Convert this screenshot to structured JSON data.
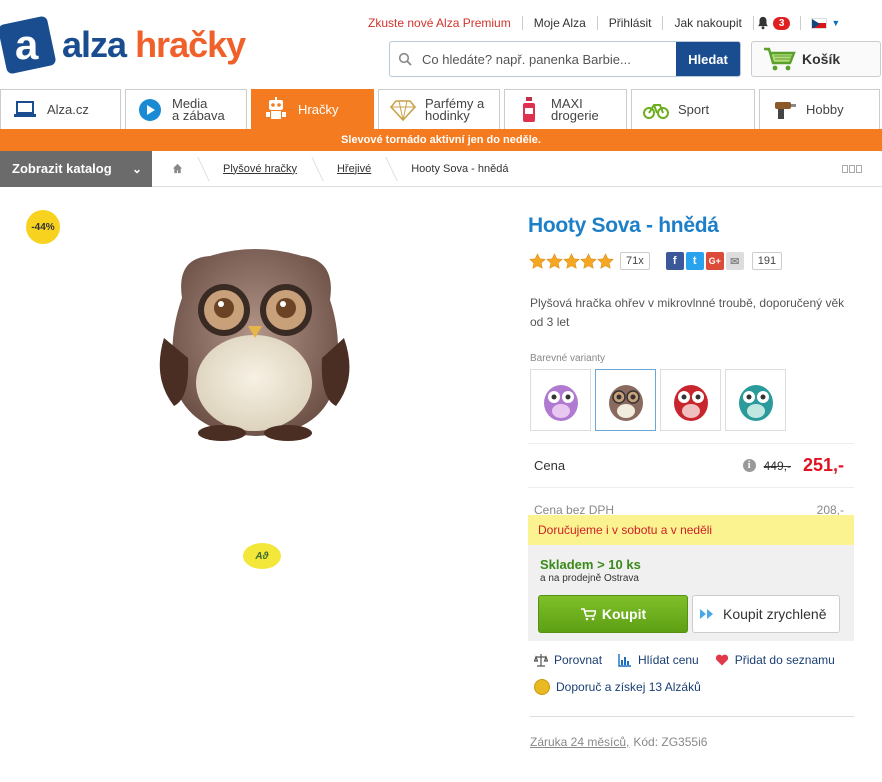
{
  "header": {
    "logo_text_1": "alza",
    "logo_text_2": "hračky",
    "logo_mark": "a",
    "toplinks": {
      "premium": "Zkuste nové Alza Premium",
      "my_alza": "Moje Alza",
      "login": "Přihlásit",
      "how_to_buy": "Jak nakoupit"
    },
    "notifications_count": "3",
    "search": {
      "placeholder": "Co hledáte? např. panenka Barbie...",
      "button": "Hledat"
    },
    "cart_label": "Košík"
  },
  "nav": {
    "tabs": [
      {
        "label": "Alza.cz",
        "icon": "laptop-icon"
      },
      {
        "label": "Media\na zábava",
        "icon": "play-icon"
      },
      {
        "label": "Hračky",
        "icon": "robot-icon"
      },
      {
        "label": "Parfémy a\nhodinky",
        "icon": "diamond-icon"
      },
      {
        "label": "MAXI\ndrogerie",
        "icon": "bottle-icon"
      },
      {
        "label": "Sport",
        "icon": "bicycle-icon"
      },
      {
        "label": "Hobby",
        "icon": "drill-icon"
      }
    ],
    "promo": "Slevové tornádo aktivní jen do neděle."
  },
  "breadcrumb": {
    "catalog_button": "Zobrazit katalog",
    "items": [
      "Plyšové hračky",
      "Hřejivé",
      "Hooty Sova - hnědá"
    ]
  },
  "product": {
    "discount_badge": "-44%",
    "brand_badge": "Aϑ",
    "title": "Hooty Sova - hnědá",
    "rating_stars": 5,
    "rating_count": "71x",
    "share_count": "191",
    "description": "Plyšová hračka ohřev v mikrovlnné troubě, doporučený věk od 3 let",
    "variants_label": "Barevné varianty",
    "variants": [
      "purple",
      "brown",
      "red",
      "teal"
    ],
    "price_label": "Cena",
    "old_price": "449,-",
    "new_price": "251,-",
    "price_no_vat_label": "Cena bez DPH",
    "price_no_vat": "208,-",
    "delivery": "Doručujeme i v sobotu a v neděli",
    "stock": "Skladem > 10 ks",
    "store": "a na prodejně Ostrava",
    "buy_button": "Koupit",
    "quick_buy_button": "Koupit zrychleně",
    "actions": {
      "compare": "Porovnat",
      "watch_price": "Hlídat cenu",
      "add_to_list": "Přidat do seznamu"
    },
    "recommend": "Doporuč a získej 13 Alzáků",
    "warranty": "Záruka 24 měsíců,",
    "code": "Kód: ZG355i6"
  },
  "colors": {
    "brand_blue": "#1a4d8f",
    "orange": "#f47b20",
    "title_blue": "#1d7fc7",
    "price_red": "#e0121f",
    "buy_green": "#6cae1e"
  }
}
